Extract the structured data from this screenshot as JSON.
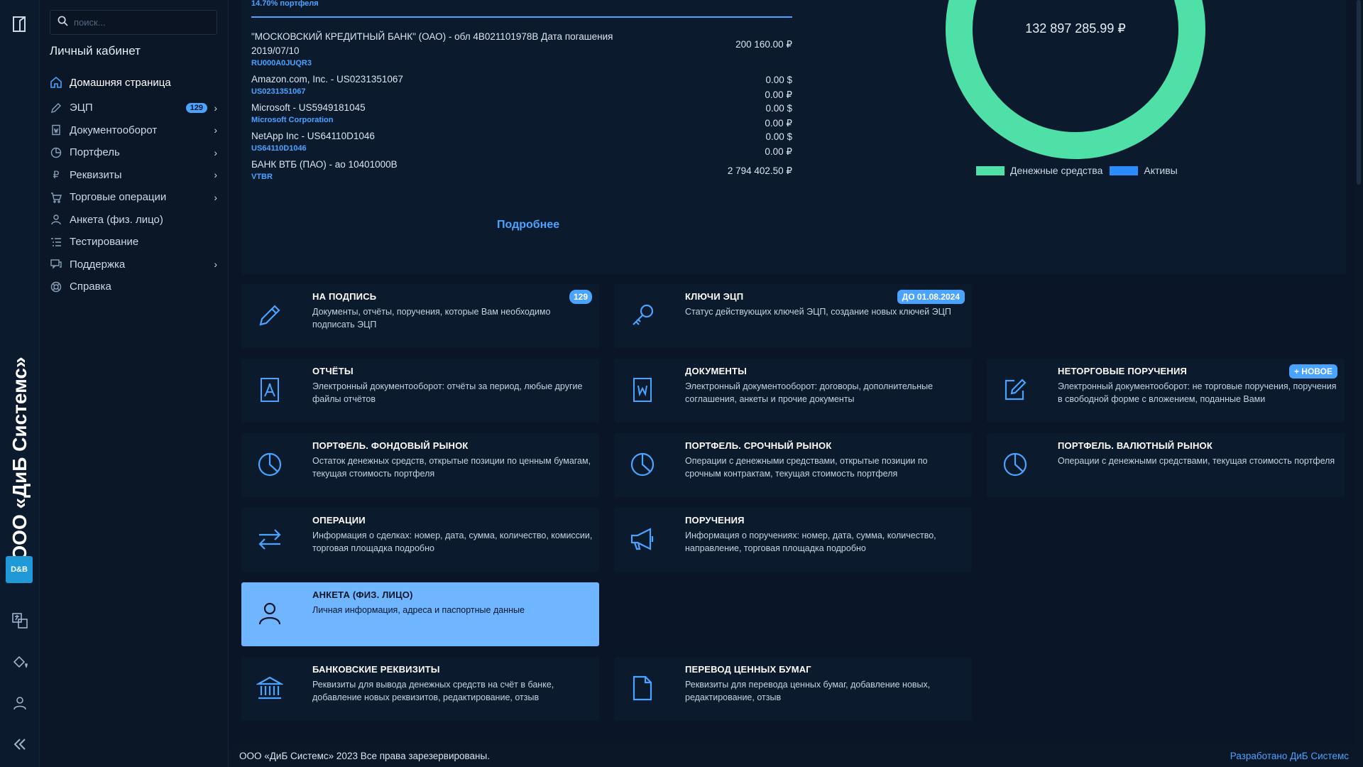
{
  "company_vertical": "ООО «ДиБ Системс»",
  "brand_logo_text": "D&B",
  "search": {
    "placeholder": "поиск..."
  },
  "sidebar": {
    "title": "Личный кабинет",
    "items": [
      {
        "label": "Домашняя страница",
        "icon": "home-icon"
      },
      {
        "label": "ЭЦП",
        "icon": "pen-icon",
        "badge": "129",
        "chevron": true
      },
      {
        "label": "Документооборот",
        "icon": "document-icon",
        "chevron": true
      },
      {
        "label": "Портфель",
        "icon": "pie-icon",
        "chevron": true
      },
      {
        "label": "Реквизиты",
        "icon": "ruble-icon",
        "chevron": true
      },
      {
        "label": "Торговые операции",
        "icon": "cart-icon",
        "chevron": true
      },
      {
        "label": "Анкета (физ. лицо)",
        "icon": "user-icon"
      },
      {
        "label": "Тестирование",
        "icon": "list-icon"
      },
      {
        "label": "Поддержка",
        "icon": "chat-icon",
        "chevron": true
      },
      {
        "label": "Справка",
        "icon": "lifebuoy-icon"
      }
    ]
  },
  "portfolio": {
    "alloc_label": "14.70% портфеля",
    "holdings": [
      {
        "name": "\"МОСКОВСКИЙ КРЕДИТНЫЙ БАНК\" (ОАО) - обл 4B021101978B Дата погашения 2019/07/10",
        "code": "RU000A0JUQR3",
        "values": [
          "200 160.00 ₽"
        ]
      },
      {
        "name": "Amazon.com, Inc. - US0231351067",
        "code": "US0231351067",
        "values": [
          "0.00 $",
          "0.00 ₽"
        ]
      },
      {
        "name": "Microsoft - US5949181045",
        "code": "Microsoft Corporation",
        "values": [
          "0.00 $",
          "0.00 ₽"
        ]
      },
      {
        "name": "NetApp Inc - US64110D1046",
        "code": "US64110D1046",
        "values": [
          "0.00 $",
          "0.00 ₽"
        ]
      },
      {
        "name": "БАНК ВТБ (ПАО) - ао 10401000B",
        "code": "VTBR",
        "values": [
          "2 794 402.50 ₽"
        ]
      }
    ],
    "more_label": "Подробнее",
    "total": "132 897 285.99 ₽",
    "legend": [
      {
        "label": "Денежные средства",
        "color": "#4ee0a6"
      },
      {
        "label": "Активы",
        "color": "#2b8cff"
      }
    ]
  },
  "cards": [
    {
      "title": "НА ПОДПИСЬ",
      "desc": "Документы, отчёты, поручения, которые Вам необходимо подписать ЭЦП",
      "icon": "pen-icon",
      "badge": "129"
    },
    {
      "title": "КЛЮЧИ ЭЦП",
      "desc": "Статус действующих ключей ЭЦП, создание новых ключей ЭЦП",
      "icon": "key-icon",
      "badge": "ДО 01.08.2024"
    },
    {
      "title": "ОТЧЁТЫ",
      "desc": "Электронный документооборот: отчёты за период, любые другие файлы отчётов",
      "icon": "pdf-icon"
    },
    {
      "title": "ДОКУМЕНТЫ",
      "desc": "Электронный документооборот: договоры, дополнительные соглашения, анкеты и прочие документы",
      "icon": "word-doc-icon"
    },
    {
      "title": "НЕТОРГОВЫЕ ПОРУЧЕНИЯ",
      "desc": "Электронный документооборот: не торговые поручения, поручения в свободной форме с вложением, поданные Вами",
      "icon": "edit-icon",
      "badge": "+ НОВОЕ"
    },
    {
      "title": "ПОРТФЕЛЬ. ФОНДОВЫЙ РЫНОК",
      "desc": "Остаток денежных средств, открытые позиции по ценным бумагам, текущая стоимость портфеля",
      "icon": "pie-icon"
    },
    {
      "title": "ПОРТФЕЛЬ. СРОЧНЫЙ РЫНОК",
      "desc": "Операции с денежными средствами, открытые позиции по срочным контрактам, текущая стоимость портфеля",
      "icon": "pie-icon"
    },
    {
      "title": "ПОРТФЕЛЬ. ВАЛЮТНЫЙ РЫНОК",
      "desc": "Операции с денежными средствами, текущая стоимость портфеля",
      "icon": "pie-icon"
    },
    {
      "title": "ОПЕРАЦИИ",
      "desc": "Информация о сделках: номер, дата, сумма, количество, комиссии, торговая площадка подробно",
      "icon": "transfer-icon"
    },
    {
      "title": "ПОРУЧЕНИЯ",
      "desc": "Информация о поручениях: номер, дата, сумма, количество, направление, торговая площадка подробно",
      "icon": "megaphone-icon"
    },
    {
      "title": "АНКЕТА (ФИЗ. ЛИЦО)",
      "desc": "Личная информация, адреса и паспортные данные",
      "icon": "user-icon"
    },
    {
      "title": "БАНКОВСКИЕ РЕКВИЗИТЫ",
      "desc": "Реквизиты для вывода денежных средств на счёт в банке, добавление новых реквизитов, редактирование, отзыв",
      "icon": "bank-icon"
    },
    {
      "title": "ПЕРЕВОД ЦЕННЫХ БУМАГ",
      "desc": "Реквизиты для перевода ценных бумаг, добавление новых, редактирование, отзыв",
      "icon": "file-icon"
    }
  ],
  "footer": {
    "copyright": "ООО «ДиБ Системс» 2023 Все права зарезервированы.",
    "developer": "Разработано ДиБ Системс"
  },
  "colors": {
    "accent": "#4aa3ff",
    "cash": "#4ee0a6",
    "assets": "#2b8cff",
    "background": "#0a1628",
    "panel": "#0c1a2e",
    "active_card": "#6fb5ff"
  }
}
